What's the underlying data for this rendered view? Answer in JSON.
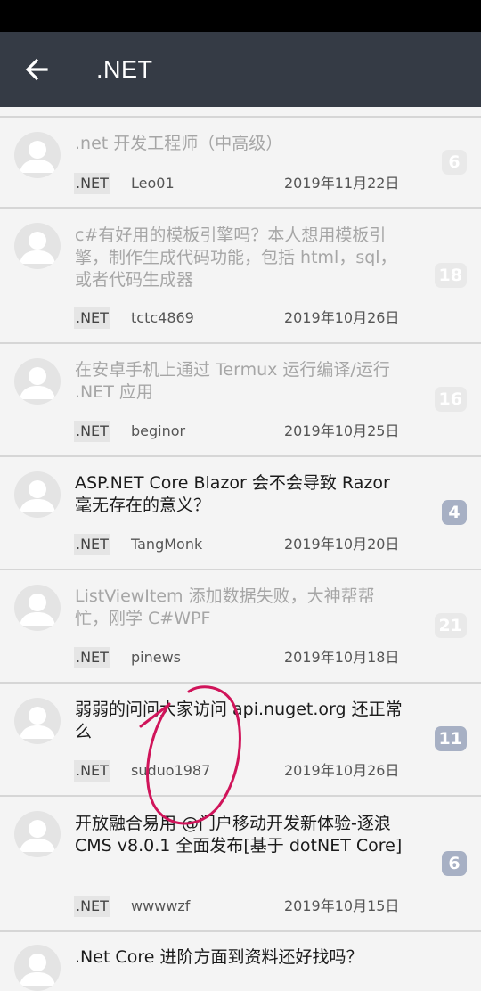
{
  "app_bar": {
    "title": ".NET",
    "back_icon": "arrow-left-icon"
  },
  "threads": [
    {
      "title": ".net 开发工程师（中高级）",
      "tag": ".NET",
      "author": "Leo01",
      "date": "2019年11月22日",
      "replies": "6",
      "read": true
    },
    {
      "title": "c#有好用的模板引擎吗？本人想用模板引擎，制作生成代码功能，包括 html，sql，或者代码生成器",
      "tag": ".NET",
      "author": "tctc4869",
      "date": "2019年10月26日",
      "replies": "18",
      "read": true
    },
    {
      "title": "在安卓手机上通过 Termux 运行编译/运行 .NET 应用",
      "tag": ".NET",
      "author": "beginor",
      "date": "2019年10月25日",
      "replies": "16",
      "read": true
    },
    {
      "title": "ASP.NET Core Blazor 会不会导致 Razor 毫无存在的意义？",
      "tag": ".NET",
      "author": "TangMonk",
      "date": "2019年10月20日",
      "replies": "4",
      "read": false
    },
    {
      "title": "ListViewItem 添加数据失败，大神帮帮忙，刚学 C#WPF",
      "tag": ".NET",
      "author": "pinews",
      "date": "2019年10月18日",
      "replies": "21",
      "read": true
    },
    {
      "title": "弱弱的问问大家访问 api.nuget.org 还正常么",
      "tag": ".NET",
      "author": "suduo1987",
      "date": "2019年10月26日",
      "replies": "11",
      "read": false
    },
    {
      "title": "开放融合易用 @门户移动开发新体验-逐浪 CMS v8.0.1 全面发布[基于 dotNET Core]",
      "tag": ".NET",
      "author": "wwwwzf",
      "date": "2019年10月15日",
      "replies": "6",
      "read": false
    },
    {
      "title": ".Net Core 进阶方面到资料还好找吗？",
      "tag": "",
      "author": "",
      "date": "",
      "replies": "",
      "read": false
    }
  ],
  "colors": {
    "app_bar": "#353b45",
    "badge_unread": "#a7b0c4",
    "badge_read": "#e9e9e9",
    "scribble": "#d0145a"
  }
}
